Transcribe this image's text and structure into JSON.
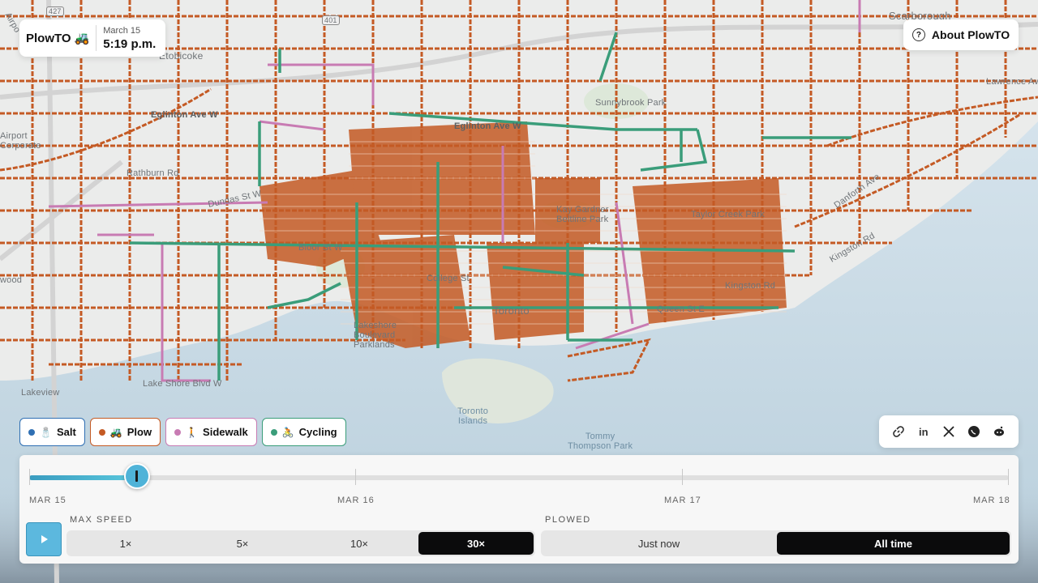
{
  "brand": {
    "name": "PlowTO",
    "emoji": "🚜",
    "date": "March 15",
    "time": "5:19 p.m."
  },
  "about": {
    "label": "About PlowTO",
    "icon": "question-circle-icon"
  },
  "legend": [
    {
      "key": "salt",
      "emoji": "🧂",
      "label": "Salt",
      "color": "#2f6fb3"
    },
    {
      "key": "plow",
      "emoji": "🚜",
      "label": "Plow",
      "color": "#c45a24"
    },
    {
      "key": "sidewalk",
      "emoji": "🚶",
      "label": "Sidewalk",
      "color": "#c87bb3"
    },
    {
      "key": "cycling",
      "emoji": "🚴",
      "label": "Cycling",
      "color": "#3a9d7a"
    }
  ],
  "share": [
    "link-icon",
    "linkedin-icon",
    "x-icon",
    "whatsapp-icon",
    "reddit-icon"
  ],
  "timeline": {
    "labels": [
      "MAR 15",
      "MAR 16",
      "MAR 17",
      "MAR 18"
    ],
    "progress": 0.11
  },
  "speed": {
    "label": "MAX SPEED",
    "options": [
      "1×",
      "5×",
      "10×",
      "30×"
    ],
    "selected": "30×"
  },
  "plowed": {
    "label": "PLOWED",
    "options": [
      "Just now",
      "All time"
    ],
    "selected": "All time"
  },
  "map": {
    "labels": {
      "scarborough": "Scarborough",
      "airport": "Airport\nCorporate",
      "eglinton_w": "Eglinton Ave W",
      "eglinton_w2": "Eglinton Ave W",
      "rathburn": "Rathburn Rd",
      "dundas": "Dundas St W",
      "bloor": "Bloor St W",
      "sunnybrook": "Sunnybrook Park",
      "taylor_creek": "Taylor Creek Park",
      "kingston": "Kingston Rd",
      "queen": "Queen St E",
      "toronto": "Toronto",
      "college": "College St",
      "lakeshore_park": "Lakeshore\nBoulevard\nParklands",
      "lakeshore_blvd": "Lake Shore Blvd W",
      "toronto_islands": "Toronto\nIslands",
      "tommy": "Tommy\nThompson Park",
      "lakeview": "Lakeview",
      "wood": "wood",
      "danforth": "Danforth Ave",
      "kingston2": "Kingston Rd",
      "lawrence": "Lawrence Ave E",
      "etobicoke": "Etobicoke",
      "airpo": "Airpo",
      "hwy401": "401",
      "hwy427": "427",
      "beltline": "Kay Gardner\nBeltline Park"
    }
  }
}
